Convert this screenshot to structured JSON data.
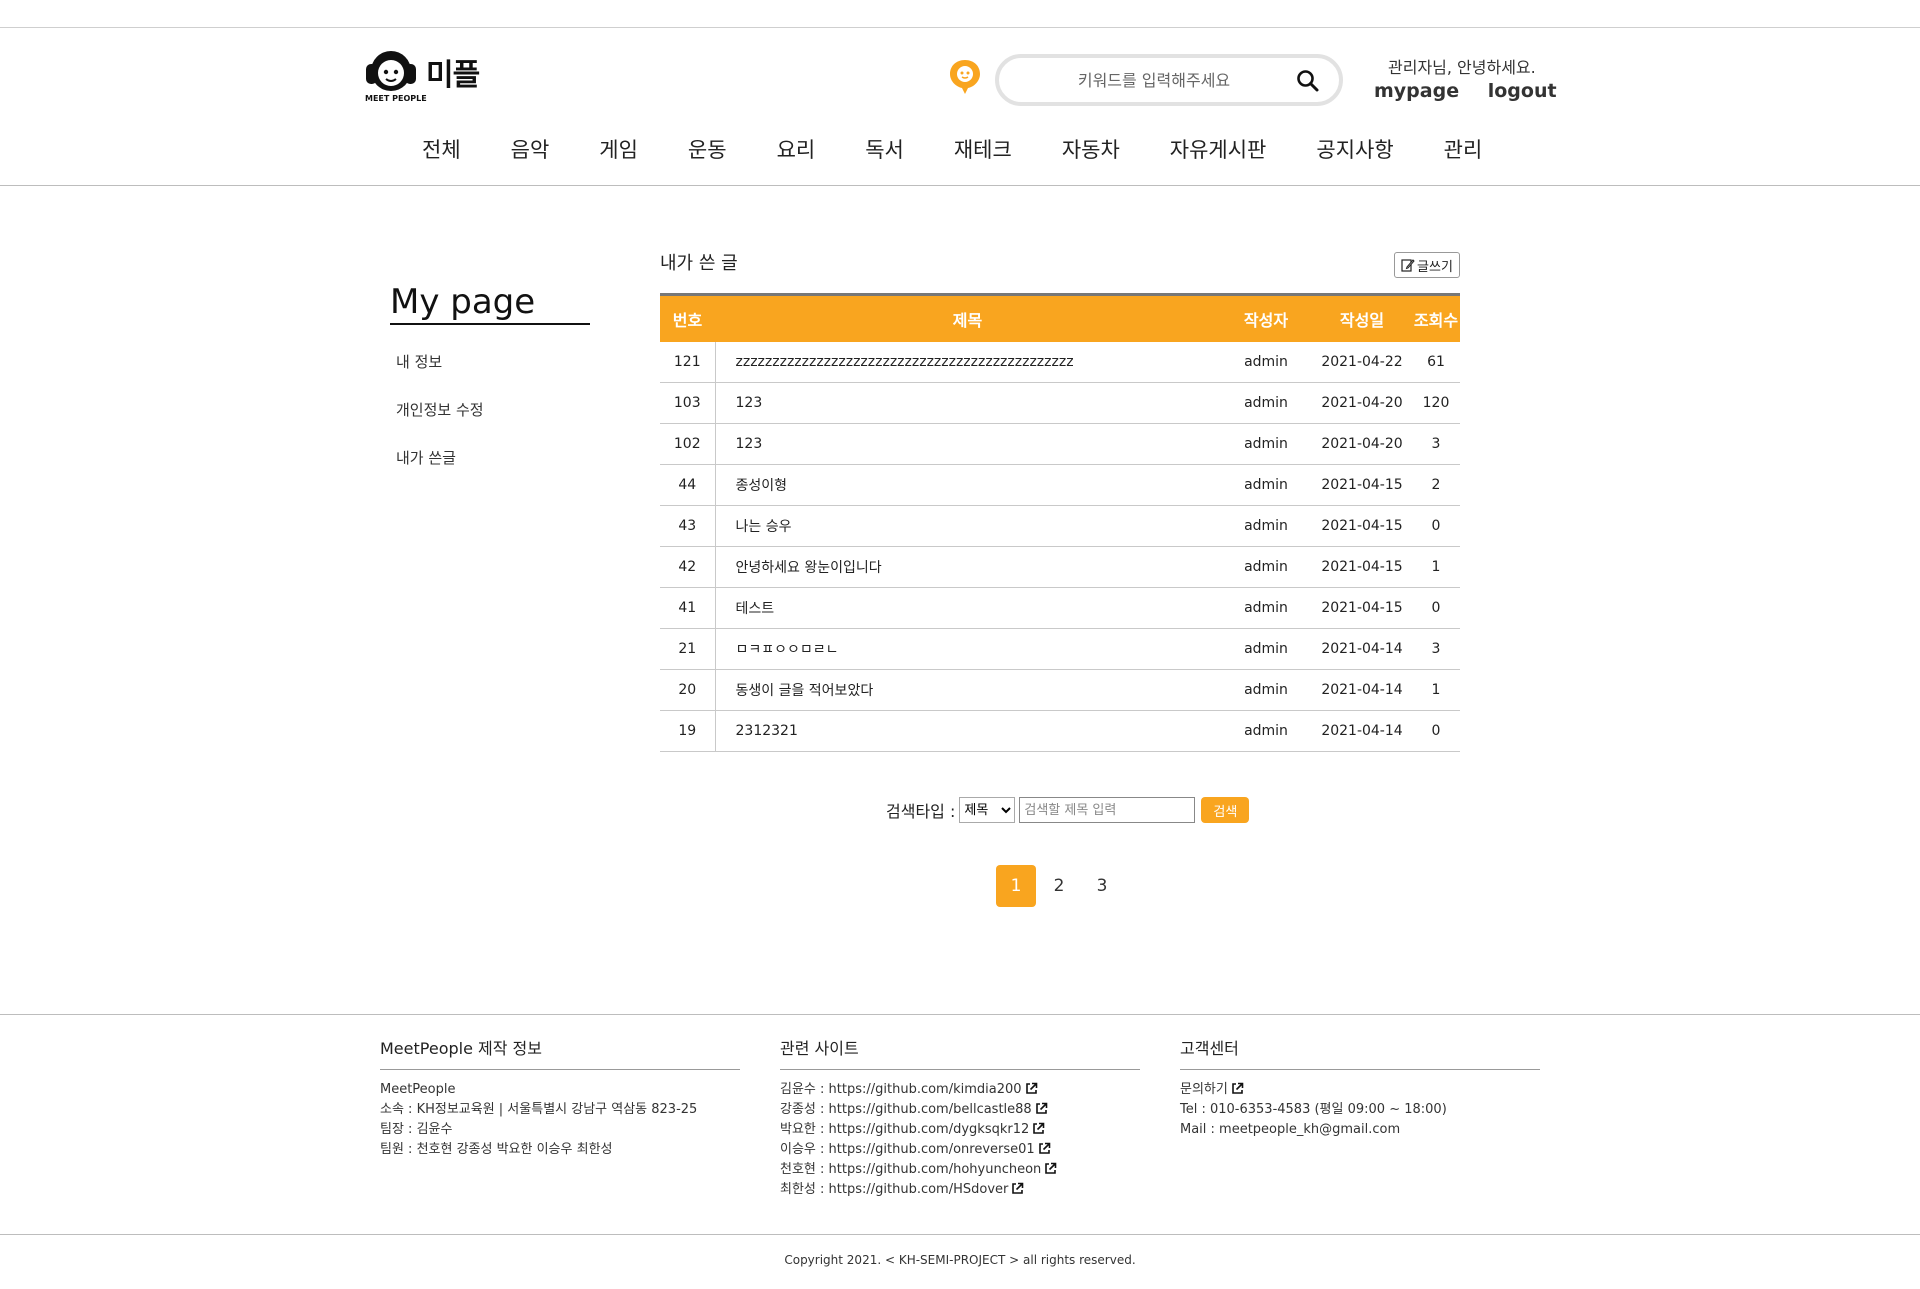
{
  "brand": {
    "name": "미플",
    "sub": "MEET PEOPLE"
  },
  "search": {
    "placeholder": "키워드를 입력해주세요"
  },
  "user": {
    "greeting": "관리자님, 안녕하세요.",
    "mypage": "mypage",
    "logout": "logout"
  },
  "nav": [
    "전체",
    "음악",
    "게임",
    "운동",
    "요리",
    "독서",
    "재테크",
    "자동차",
    "자유게시판",
    "공지사항",
    "관리"
  ],
  "sidebar": {
    "title": "My page",
    "items": [
      "내 정보",
      "개인정보 수정",
      "내가 쓴글"
    ]
  },
  "main": {
    "title": "내가 쓴 글",
    "write_label": "글쓰기",
    "columns": [
      "번호",
      "제목",
      "작성자",
      "작성일",
      "조회수"
    ],
    "rows": [
      {
        "no": "121",
        "title": "zzzzzzzzzzzzzzzzzzzzzzzzzzzzzzzzzzzzzzzzzzzzzz",
        "author": "admin",
        "date": "2021-04-22",
        "views": "61"
      },
      {
        "no": "103",
        "title": "123",
        "author": "admin",
        "date": "2021-04-20",
        "views": "120"
      },
      {
        "no": "102",
        "title": "123",
        "author": "admin",
        "date": "2021-04-20",
        "views": "3"
      },
      {
        "no": "44",
        "title": "종성이형",
        "author": "admin",
        "date": "2021-04-15",
        "views": "2"
      },
      {
        "no": "43",
        "title": "나는 승우",
        "author": "admin",
        "date": "2021-04-15",
        "views": "0"
      },
      {
        "no": "42",
        "title": "안녕하세요 왕눈이입니다",
        "author": "admin",
        "date": "2021-04-15",
        "views": "1"
      },
      {
        "no": "41",
        "title": "테스트",
        "author": "admin",
        "date": "2021-04-15",
        "views": "0"
      },
      {
        "no": "21",
        "title": "ㅁㅋㅍㅇㅇㅁㄹㄴ",
        "author": "admin",
        "date": "2021-04-14",
        "views": "3"
      },
      {
        "no": "20",
        "title": "동생이 글을 적어보았다",
        "author": "admin",
        "date": "2021-04-14",
        "views": "1"
      },
      {
        "no": "19",
        "title": "2312321",
        "author": "admin",
        "date": "2021-04-14",
        "views": "0"
      }
    ]
  },
  "board_search": {
    "label": "검색타입 :",
    "type_selected": "제목",
    "placeholder": "검색할 제목 입력",
    "button": "검색"
  },
  "pagination": {
    "pages": [
      "1",
      "2",
      "3"
    ],
    "active": "1"
  },
  "footer": {
    "info": {
      "heading": "MeetPeople 제작 정보",
      "lines": [
        "MeetPeople",
        "소속 : KH정보교육원 | 서울특별시 강남구 역삼동 823-25",
        "팀장 : 김윤수",
        "팀원 : 천호현 강종성 박요한 이승우 최한성"
      ]
    },
    "sites": {
      "heading": "관련 사이트",
      "links": [
        {
          "name": "김윤수 : ",
          "url": "https://github.com/kimdia200"
        },
        {
          "name": "강종성 : ",
          "url": "https://github.com/bellcastle88"
        },
        {
          "name": "박요한 : ",
          "url": "https://github.com/dygksqkr12"
        },
        {
          "name": "이승우 : ",
          "url": "https://github.com/onreverse01"
        },
        {
          "name": "천호현 : ",
          "url": "https://github.com/hohyuncheon"
        },
        {
          "name": "최한성 : ",
          "url": "https://github.com/HSdover"
        }
      ]
    },
    "support": {
      "heading": "고객센터",
      "contact": "문의하기",
      "tel": "Tel : 010-6353-4583 (평일 09:00 ~ 18:00)",
      "mail": "Mail : meetpeople_kh@gmail.com"
    },
    "copyright": "Copyright 2021. < KH-SEMI-PROJECT > all rights reserved."
  },
  "colors": {
    "accent": "#f9a51f"
  }
}
